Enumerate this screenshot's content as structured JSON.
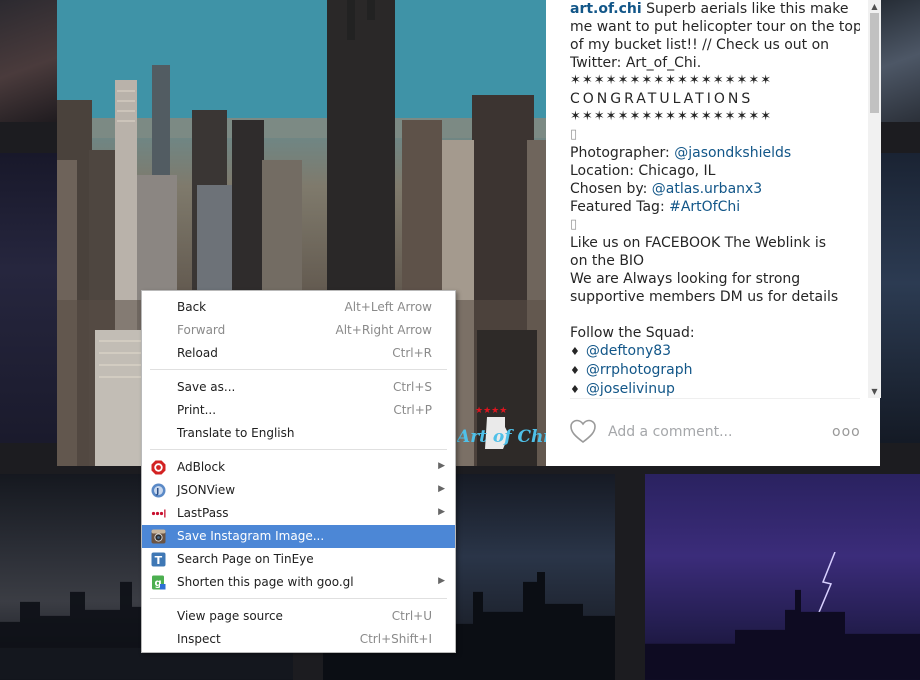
{
  "post": {
    "owner": "art.of.chi",
    "caption_lines": [
      " Superb aerials like this make",
      "me want to put helicopter tour on the top",
      "of my bucket list!! // Check us out on",
      "Twitter: Art_of_Chi."
    ],
    "stars": "✶✶✶✶✶✶✶✶✶✶✶✶✶✶✶✶✶",
    "congrats": "CONGRATULATIONS",
    "box_char": "▯",
    "photographer_label": "Photographer: ",
    "photographer": "@jasondkshields",
    "location": "Location: Chicago, IL",
    "chosen_label": "Chosen by: ",
    "chosen": "@atlas.urbanx3",
    "tag_label": "Featured Tag: ",
    "tag": "#ArtOfChi",
    "facebook_lines": [
      "Like us on FACEBOOK The Weblink is",
      "on the BIO"
    ],
    "recruit_lines": [
      "We are Always looking for strong",
      "supportive members DM us for details"
    ],
    "squad_label": "Follow the Squad:",
    "bullet": "♦",
    "squad": [
      "@deftony83",
      "@rrphotograph",
      "@joselivinup"
    ],
    "comment_placeholder": "Add a comment...",
    "more": "ooo",
    "watermark": "Art of Chi"
  },
  "menu": {
    "items": [
      {
        "label": "Back",
        "shortcut": "Alt+Left Arrow"
      },
      {
        "label": "Forward",
        "shortcut": "Alt+Right Arrow"
      },
      {
        "label": "Reload",
        "shortcut": "Ctrl+R"
      },
      {
        "label": "Save as...",
        "shortcut": "Ctrl+S"
      },
      {
        "label": "Print...",
        "shortcut": "Ctrl+P"
      },
      {
        "label": "Translate to English",
        "shortcut": ""
      },
      {
        "label": "AdBlock",
        "shortcut": ""
      },
      {
        "label": "JSONView",
        "shortcut": ""
      },
      {
        "label": "LastPass",
        "shortcut": ""
      },
      {
        "label": "Save Instagram Image...",
        "shortcut": ""
      },
      {
        "label": "Search Page on TinEye",
        "shortcut": ""
      },
      {
        "label": "Shorten this page with goo.gl",
        "shortcut": ""
      },
      {
        "label": "View page source",
        "shortcut": "Ctrl+U"
      },
      {
        "label": "Inspect",
        "shortcut": "Ctrl+Shift+I"
      }
    ],
    "submenu_arrow": "▶",
    "icons": {
      "adblock": "O",
      "jsonview": "J",
      "lastpass": "•••",
      "tineye": "T",
      "googl": "g"
    }
  },
  "colors": {
    "link": "#125688",
    "menu_highlight": "#4c87d6",
    "adblock_red": "#d32222",
    "lastpass_red": "#c8102e"
  }
}
